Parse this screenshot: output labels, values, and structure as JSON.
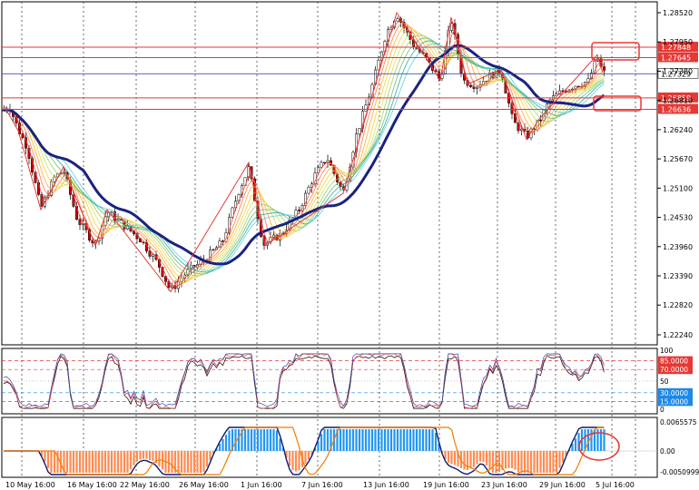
{
  "chart_data": {
    "type": "candlestick",
    "price_axis_labels": [
      "1.28520",
      "1.27950",
      "1.27380",
      "1.26810",
      "1.26240",
      "1.25670",
      "1.25100",
      "1.24530",
      "1.23960",
      "1.23390",
      "1.22820",
      "1.22240"
    ],
    "price_levels": [
      1.2852,
      1.2795,
      1.2738,
      1.2681,
      1.2624,
      1.2567,
      1.251,
      1.2453,
      1.2396,
      1.2339,
      1.2282,
      1.2224
    ],
    "time_labels": [
      "10 May 16:00",
      "16 May 16:00",
      "22 May 16:00",
      "26 May 16:00",
      "1 Jun 16:00",
      "7 Jun 16:00",
      "13 Jun 16:00",
      "19 Jun 16:00",
      "23 Jun 16:00",
      "29 Jun 16:00",
      "5 Jul 16:00"
    ],
    "current_price": "1.27329",
    "horizontal_lines": [
      {
        "label": "1.27848",
        "price": 1.27848
      },
      {
        "label": "1.27645",
        "price": 1.27645
      },
      {
        "label": "1.26859",
        "price": 1.26859
      },
      {
        "label": "1.26636",
        "price": 1.26636
      }
    ],
    "rsi": {
      "axis_labels": [
        "100",
        "50",
        "0"
      ],
      "levels": [
        {
          "label": "85.0000",
          "value": 85
        },
        {
          "label": "70.0000",
          "value": 70
        },
        {
          "label": "30.0000",
          "value": 30
        },
        {
          "label": "15.0000",
          "value": 15
        }
      ]
    },
    "macd": {
      "axis_labels": [
        "0.0065575",
        "0.00",
        "-0.0050999"
      ]
    },
    "colors": {
      "bull": "#ffffff",
      "bear": "#d40000",
      "candle_outline": "#000000",
      "ma_slow": "#1a237e",
      "resistance": "#e53935",
      "support": "#e53935",
      "current_line": "#3f51b5",
      "macd_pos": "#2196f3",
      "macd_neg": "#ff8a50"
    }
  }
}
